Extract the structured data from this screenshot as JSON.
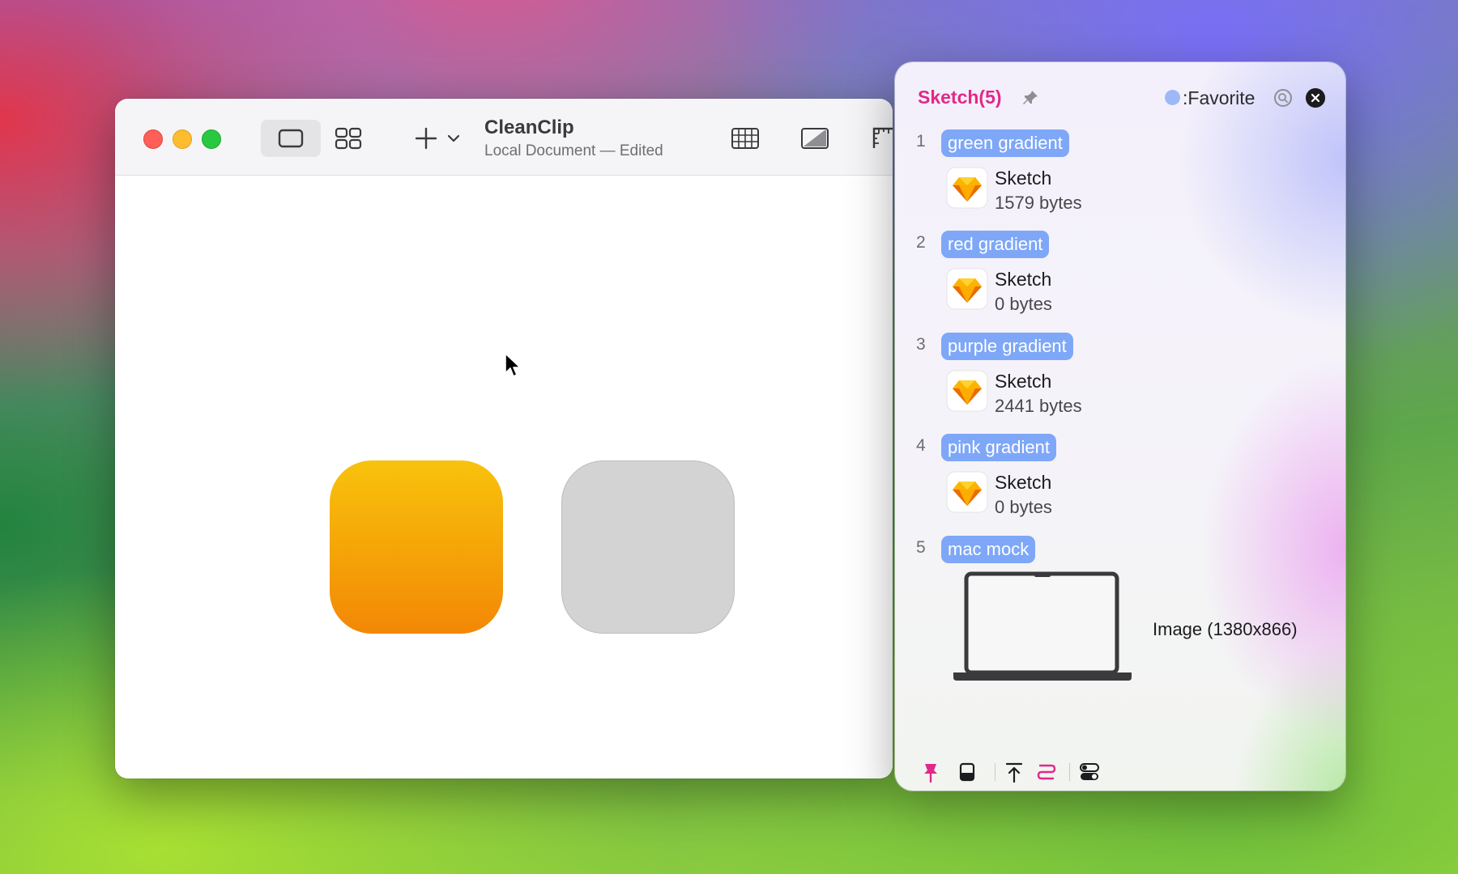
{
  "window": {
    "title": "CleanClip",
    "subtitle": "Local Document — Edited"
  },
  "panel": {
    "title": "Sketch(5)",
    "favorite_label": ":Favorite",
    "items": [
      {
        "index": "1",
        "tag": "green gradient",
        "type": "Sketch",
        "size": "1579 bytes"
      },
      {
        "index": "2",
        "tag": "red gradient",
        "type": "Sketch",
        "size": "0 bytes"
      },
      {
        "index": "3",
        "tag": "purple gradient",
        "type": "Sketch",
        "size": "2441 bytes"
      },
      {
        "index": "4",
        "tag": "pink gradient",
        "type": "Sketch",
        "size": "0 bytes"
      },
      {
        "index": "5",
        "tag": "mac mock",
        "type": "Image (1380x866)"
      }
    ]
  },
  "colors": {
    "accent_pink": "#e0298a",
    "tag_blue": "#7ea7f8",
    "orange_shape": "#f5a308",
    "gray_shape": "#d3d3d3"
  },
  "icons": {
    "pin": "pin-icon",
    "search": "search-icon",
    "close": "close-icon",
    "sketch": "sketch-diamond-icon",
    "laptop": "laptop-icon"
  }
}
